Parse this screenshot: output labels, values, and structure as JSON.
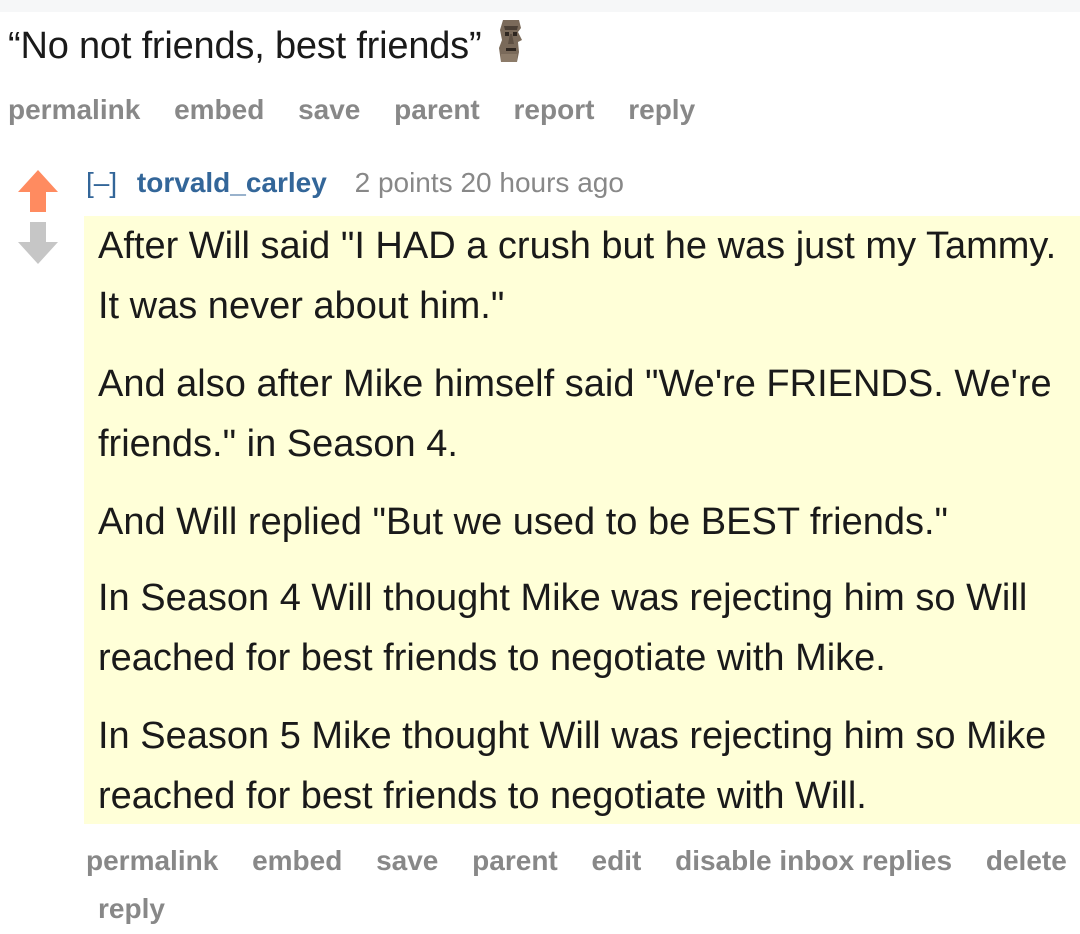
{
  "parent_comment": {
    "text": "“No not friends, best friends”",
    "emoji": "moai-icon",
    "actions": [
      "permalink",
      "embed",
      "save",
      "parent",
      "report",
      "reply"
    ]
  },
  "comment": {
    "collapse": "[–]",
    "author": "torvald_carley",
    "score": "2 points",
    "time": "20 hours ago",
    "highlight_color": "#ffffd8",
    "upvote_color": "#ff8b60",
    "author_color": "#336699",
    "paragraphs": [
      "After Will said \"I HAD a crush but he was just my Tammy. It was never about him.\"",
      "And also after Mike himself said \"We're FRIENDS. We're friends.\" in Season 4.",
      "And Will replied \"But we used to be BEST friends.\"",
      "In Season 4 Will thought Mike was rejecting him so Will reached for best friends to negotiate with Mike.",
      "In Season 5 Mike thought Will was rejecting him so Mike reached for best friends to negotiate with Will."
    ],
    "actions": [
      "permalink",
      "embed",
      "save",
      "parent",
      "edit",
      "disable inbox replies",
      "delete",
      "reply"
    ]
  }
}
